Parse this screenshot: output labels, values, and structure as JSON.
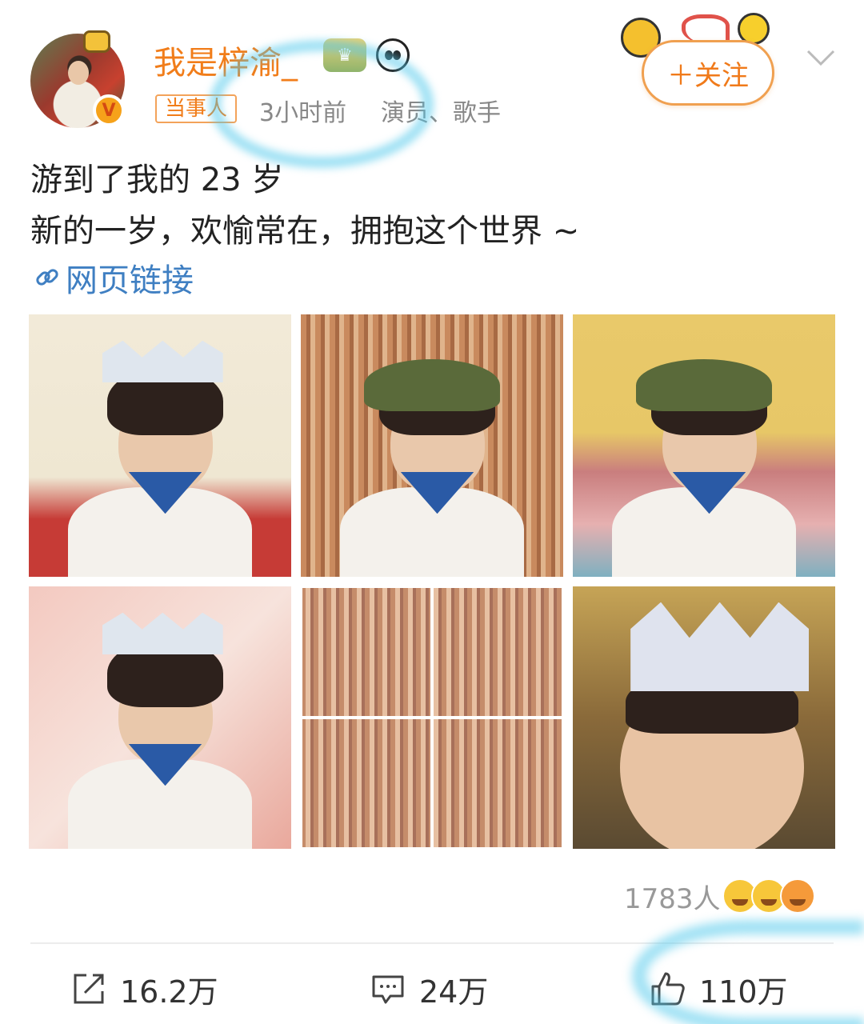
{
  "author": {
    "name": "我是梓渝_",
    "role_tag": "当事人",
    "time": "3小时前",
    "profession": "演员、歌手",
    "verified_mark": "V"
  },
  "follow": {
    "label": "＋关注"
  },
  "post": {
    "line1": "游到了我的 23 岁",
    "line2": "新的一岁，欢愉常在，拥抱这个世界 ~",
    "link_label": "网页链接"
  },
  "photos": [
    {
      "id": "photo-1"
    },
    {
      "id": "photo-2"
    },
    {
      "id": "photo-3"
    },
    {
      "id": "photo-4"
    },
    {
      "id": "photo-5"
    },
    {
      "id": "photo-6"
    }
  ],
  "reactions": {
    "count": "1783人"
  },
  "actions": {
    "repost": "16.2万",
    "comment": "24万",
    "like": "110万"
  },
  "colors": {
    "name_orange": "#f17d1a",
    "link_blue": "#3f7fc2",
    "highlight_cyan": "#50c8eb"
  }
}
